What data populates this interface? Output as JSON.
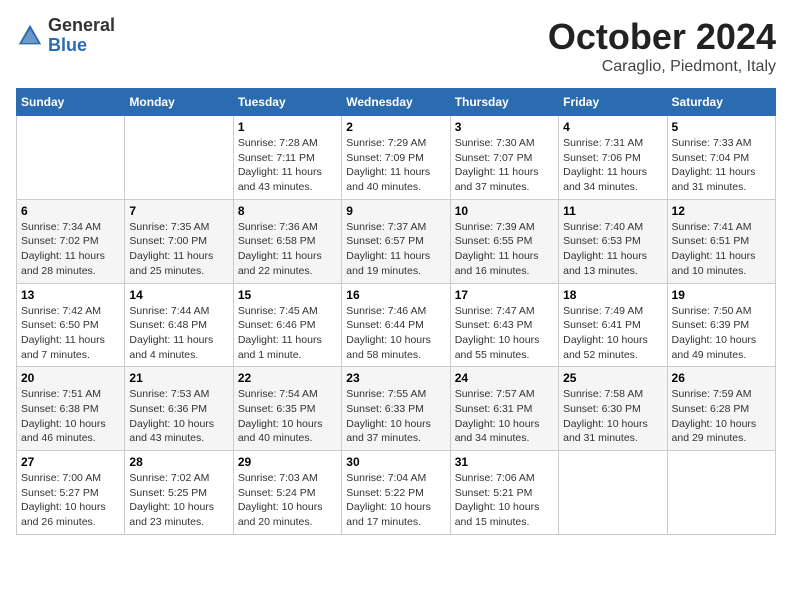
{
  "header": {
    "logo_general": "General",
    "logo_blue": "Blue",
    "title": "October 2024",
    "location": "Caraglio, Piedmont, Italy"
  },
  "days_of_week": [
    "Sunday",
    "Monday",
    "Tuesday",
    "Wednesday",
    "Thursday",
    "Friday",
    "Saturday"
  ],
  "weeks": [
    [
      {
        "day": "",
        "info": ""
      },
      {
        "day": "",
        "info": ""
      },
      {
        "day": "1",
        "info": "Sunrise: 7:28 AM\nSunset: 7:11 PM\nDaylight: 11 hours and 43 minutes."
      },
      {
        "day": "2",
        "info": "Sunrise: 7:29 AM\nSunset: 7:09 PM\nDaylight: 11 hours and 40 minutes."
      },
      {
        "day": "3",
        "info": "Sunrise: 7:30 AM\nSunset: 7:07 PM\nDaylight: 11 hours and 37 minutes."
      },
      {
        "day": "4",
        "info": "Sunrise: 7:31 AM\nSunset: 7:06 PM\nDaylight: 11 hours and 34 minutes."
      },
      {
        "day": "5",
        "info": "Sunrise: 7:33 AM\nSunset: 7:04 PM\nDaylight: 11 hours and 31 minutes."
      }
    ],
    [
      {
        "day": "6",
        "info": "Sunrise: 7:34 AM\nSunset: 7:02 PM\nDaylight: 11 hours and 28 minutes."
      },
      {
        "day": "7",
        "info": "Sunrise: 7:35 AM\nSunset: 7:00 PM\nDaylight: 11 hours and 25 minutes."
      },
      {
        "day": "8",
        "info": "Sunrise: 7:36 AM\nSunset: 6:58 PM\nDaylight: 11 hours and 22 minutes."
      },
      {
        "day": "9",
        "info": "Sunrise: 7:37 AM\nSunset: 6:57 PM\nDaylight: 11 hours and 19 minutes."
      },
      {
        "day": "10",
        "info": "Sunrise: 7:39 AM\nSunset: 6:55 PM\nDaylight: 11 hours and 16 minutes."
      },
      {
        "day": "11",
        "info": "Sunrise: 7:40 AM\nSunset: 6:53 PM\nDaylight: 11 hours and 13 minutes."
      },
      {
        "day": "12",
        "info": "Sunrise: 7:41 AM\nSunset: 6:51 PM\nDaylight: 11 hours and 10 minutes."
      }
    ],
    [
      {
        "day": "13",
        "info": "Sunrise: 7:42 AM\nSunset: 6:50 PM\nDaylight: 11 hours and 7 minutes."
      },
      {
        "day": "14",
        "info": "Sunrise: 7:44 AM\nSunset: 6:48 PM\nDaylight: 11 hours and 4 minutes."
      },
      {
        "day": "15",
        "info": "Sunrise: 7:45 AM\nSunset: 6:46 PM\nDaylight: 11 hours and 1 minute."
      },
      {
        "day": "16",
        "info": "Sunrise: 7:46 AM\nSunset: 6:44 PM\nDaylight: 10 hours and 58 minutes."
      },
      {
        "day": "17",
        "info": "Sunrise: 7:47 AM\nSunset: 6:43 PM\nDaylight: 10 hours and 55 minutes."
      },
      {
        "day": "18",
        "info": "Sunrise: 7:49 AM\nSunset: 6:41 PM\nDaylight: 10 hours and 52 minutes."
      },
      {
        "day": "19",
        "info": "Sunrise: 7:50 AM\nSunset: 6:39 PM\nDaylight: 10 hours and 49 minutes."
      }
    ],
    [
      {
        "day": "20",
        "info": "Sunrise: 7:51 AM\nSunset: 6:38 PM\nDaylight: 10 hours and 46 minutes."
      },
      {
        "day": "21",
        "info": "Sunrise: 7:53 AM\nSunset: 6:36 PM\nDaylight: 10 hours and 43 minutes."
      },
      {
        "day": "22",
        "info": "Sunrise: 7:54 AM\nSunset: 6:35 PM\nDaylight: 10 hours and 40 minutes."
      },
      {
        "day": "23",
        "info": "Sunrise: 7:55 AM\nSunset: 6:33 PM\nDaylight: 10 hours and 37 minutes."
      },
      {
        "day": "24",
        "info": "Sunrise: 7:57 AM\nSunset: 6:31 PM\nDaylight: 10 hours and 34 minutes."
      },
      {
        "day": "25",
        "info": "Sunrise: 7:58 AM\nSunset: 6:30 PM\nDaylight: 10 hours and 31 minutes."
      },
      {
        "day": "26",
        "info": "Sunrise: 7:59 AM\nSunset: 6:28 PM\nDaylight: 10 hours and 29 minutes."
      }
    ],
    [
      {
        "day": "27",
        "info": "Sunrise: 7:00 AM\nSunset: 5:27 PM\nDaylight: 10 hours and 26 minutes."
      },
      {
        "day": "28",
        "info": "Sunrise: 7:02 AM\nSunset: 5:25 PM\nDaylight: 10 hours and 23 minutes."
      },
      {
        "day": "29",
        "info": "Sunrise: 7:03 AM\nSunset: 5:24 PM\nDaylight: 10 hours and 20 minutes."
      },
      {
        "day": "30",
        "info": "Sunrise: 7:04 AM\nSunset: 5:22 PM\nDaylight: 10 hours and 17 minutes."
      },
      {
        "day": "31",
        "info": "Sunrise: 7:06 AM\nSunset: 5:21 PM\nDaylight: 10 hours and 15 minutes."
      },
      {
        "day": "",
        "info": ""
      },
      {
        "day": "",
        "info": ""
      }
    ]
  ]
}
